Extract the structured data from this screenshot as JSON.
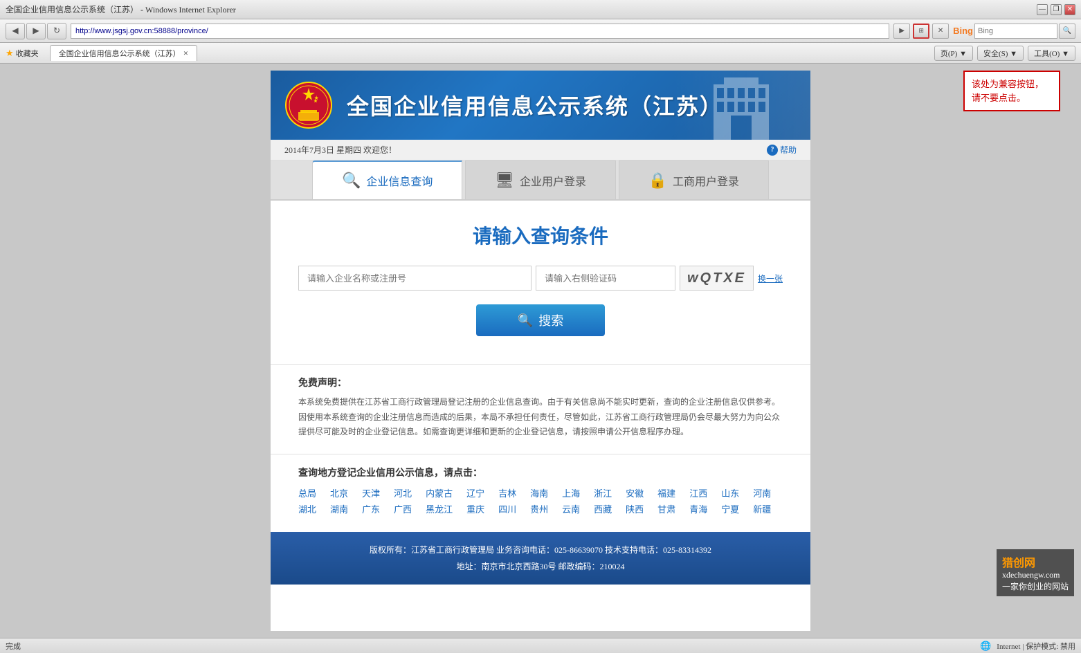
{
  "browser": {
    "title": "全国企业信用信息公示系统（江苏） - Windows Internet Explorer",
    "url": "http://www.jsgsj.gov.cn:58888/province/",
    "tab_label": "全国企业信用信息公示系统（江苏）",
    "favorites_label": "收藏夹",
    "bing_placeholder": "Bing",
    "toolbar_buttons": [
      "页(P)▼",
      "安全(S)▼",
      "工具(O)▼"
    ],
    "status_text": "完成",
    "status_zone": "Internet | 保护模式: 禁用"
  },
  "annotation": {
    "text": "该处为兼容按钮，请不要点击。"
  },
  "header": {
    "title": "全国企业信用信息公示系统（江苏）"
  },
  "info_bar": {
    "date_text": "2014年7月3日 星期四  欢迎您！",
    "help_label": "帮助"
  },
  "tabs": [
    {
      "id": "tab-query",
      "label": "企业信息查询",
      "active": true,
      "icon": "🔍"
    },
    {
      "id": "tab-enterprise",
      "label": "企业用户登录",
      "active": false,
      "icon": "🖥"
    },
    {
      "id": "tab-commerce",
      "label": "工商用户登录",
      "active": false,
      "icon": "🔒"
    }
  ],
  "search": {
    "title": "请输入查询条件",
    "company_placeholder": "请输入企业名称或注册号",
    "captcha_placeholder": "请输入右侧验证码",
    "captcha_text": "wQTXE",
    "refresh_label": "换一张",
    "search_label": "搜索"
  },
  "disclaimer": {
    "title": "免费声明：",
    "text": "本系统免费提供在江苏省工商行政管理局登记注册的企业信息查询。由于有关信息尚不能实时更新，查询的企业注册信息仅供参考。因使用本系统查询的企业注册信息而造成的后果，本局不承担任何责任，尽管如此，江苏省工商行政管理局仍会尽最大努力为向公众提供尽可能及时的企业登记信息。如需查询更详细和更新的企业登记信息，请按照申请公开信息程序办理。"
  },
  "regional": {
    "title": "查询地方登记企业信用公示信息，请点击：",
    "rows": [
      [
        "总局",
        "北京",
        "天津",
        "河北",
        "内蒙古",
        "辽宁",
        "吉林",
        "海南",
        "上海",
        "浙江",
        "安徽",
        "福建",
        "江西",
        "山东",
        "河南"
      ],
      [
        "湖北",
        "湖南",
        "广东",
        "广西",
        "黑龙江",
        "重庆",
        "四川",
        "贵州",
        "云南",
        "西藏",
        "陕西",
        "甘肃",
        "青海",
        "宁夏",
        "新疆"
      ]
    ]
  },
  "footer": {
    "line1": "版权所有：江苏省工商行政管理局    业务咨询电话：025-86639070    技术支持电话：025-83314392",
    "line2": "地址：南京市北京西路30号    邮政编码：210024"
  },
  "watermark": {
    "line1": "猎创网",
    "line2": "xdechuengw.com",
    "line3": "一家你创业的网站"
  }
}
